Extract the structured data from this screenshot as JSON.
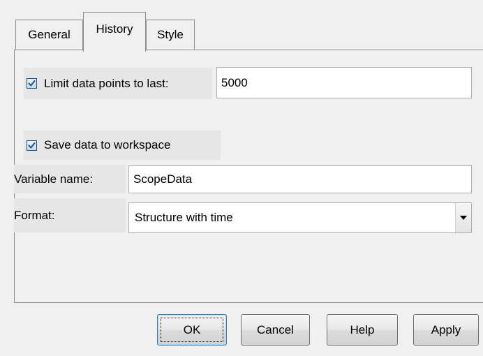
{
  "tabs": [
    {
      "label": "General",
      "selected": false
    },
    {
      "label": "History",
      "selected": true
    },
    {
      "label": "Style",
      "selected": false
    }
  ],
  "history": {
    "limit": {
      "label": "Limit data points to last:",
      "checked": true,
      "value": "5000"
    },
    "save": {
      "label": "Save data to workspace",
      "checked": true
    },
    "variable_name": {
      "label": "Variable name:",
      "value": "ScopeData"
    },
    "format": {
      "label": "Format:",
      "selected": "Structure with time"
    }
  },
  "buttons": {
    "ok": "OK",
    "cancel": "Cancel",
    "help": "Help",
    "apply": "Apply"
  },
  "colors": {
    "background": "#f0f0f0",
    "label_background": "#e6e6e6",
    "checkbox_check": "#1c5180",
    "focus_border": "#3c7fb1"
  },
  "icons": {
    "checkbox": "checkmark-icon",
    "dropdown": "chevron-down-icon"
  }
}
